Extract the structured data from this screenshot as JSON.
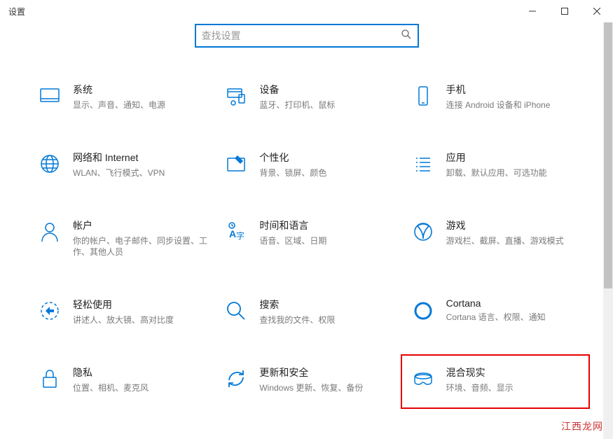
{
  "window": {
    "title": "设置"
  },
  "search": {
    "placeholder": "查找设置"
  },
  "categories": [
    {
      "id": "system",
      "title": "系统",
      "desc": "显示、声音、通知、电源"
    },
    {
      "id": "devices",
      "title": "设备",
      "desc": "蓝牙、打印机、鼠标"
    },
    {
      "id": "phone",
      "title": "手机",
      "desc": "连接 Android 设备和 iPhone"
    },
    {
      "id": "network",
      "title": "网络和 Internet",
      "desc": "WLAN、飞行模式、VPN"
    },
    {
      "id": "personalization",
      "title": "个性化",
      "desc": "背景、锁屏、颜色"
    },
    {
      "id": "apps",
      "title": "应用",
      "desc": "卸载、默认应用、可选功能"
    },
    {
      "id": "accounts",
      "title": "帐户",
      "desc": "你的帐户、电子邮件、同步设置、工作、其他人员"
    },
    {
      "id": "time",
      "title": "时间和语言",
      "desc": "语音、区域、日期"
    },
    {
      "id": "gaming",
      "title": "游戏",
      "desc": "游戏栏、截屏、直播、游戏模式"
    },
    {
      "id": "ease",
      "title": "轻松使用",
      "desc": "讲述人、放大镜、高对比度"
    },
    {
      "id": "search-cat",
      "title": "搜索",
      "desc": "查找我的文件、权限"
    },
    {
      "id": "cortana",
      "title": "Cortana",
      "desc": "Cortana 语言、权限、通知"
    },
    {
      "id": "privacy",
      "title": "隐私",
      "desc": "位置、相机、麦克风"
    },
    {
      "id": "update",
      "title": "更新和安全",
      "desc": "Windows 更新、恢复、备份"
    },
    {
      "id": "mixed",
      "title": "混合现实",
      "desc": "环境、音频、显示"
    }
  ],
  "watermark": "江西龙网"
}
